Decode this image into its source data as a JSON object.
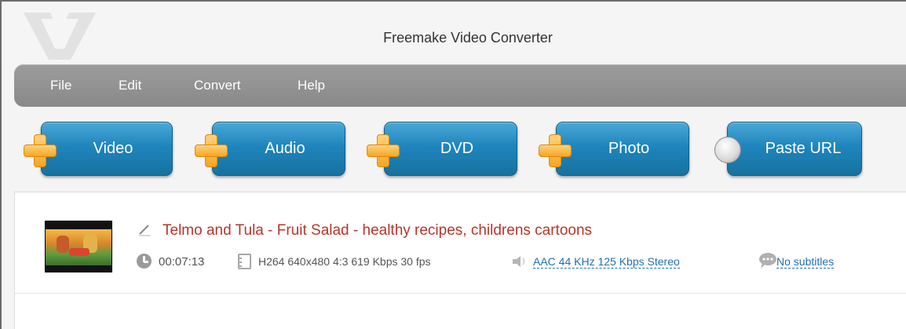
{
  "app": {
    "title": "Freemake Video Converter"
  },
  "menu": {
    "items": [
      "File",
      "Edit",
      "Convert",
      "Help"
    ]
  },
  "toolbar": {
    "buttons": [
      {
        "label": "Video",
        "icon": "plus-icon"
      },
      {
        "label": "Audio",
        "icon": "plus-icon"
      },
      {
        "label": "DVD",
        "icon": "plus-icon"
      },
      {
        "label": "Photo",
        "icon": "plus-icon"
      },
      {
        "label": "Paste URL",
        "icon": "globe-icon"
      }
    ]
  },
  "file": {
    "title": "Telmo and Tula - Fruit Salad - healthy recipes, childrens cartoons",
    "duration": "00:07:13",
    "video_info": "H264  640x480  4:3  619 Kbps  30 fps",
    "audio_info": "AAC  44 KHz  125 Kbps  Stereo",
    "subtitles": "No subtitles"
  },
  "colors": {
    "accent_blue": "#1f85bd",
    "plus_orange": "#f5a623",
    "title_red": "#b3372a",
    "link_blue": "#1f6fb3",
    "menubar_gray": "#919191"
  }
}
